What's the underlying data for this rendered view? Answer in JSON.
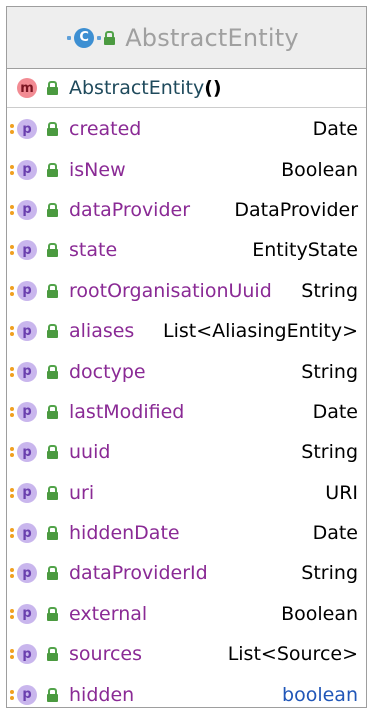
{
  "header": {
    "class_icon": "C",
    "class_name": "AbstractEntity"
  },
  "constructor": {
    "icon": "m",
    "name": "AbstractEntity",
    "parens": "()"
  },
  "property_icon": "p",
  "properties": [
    {
      "name": "created",
      "type": "Date",
      "primitive": false
    },
    {
      "name": "isNew",
      "type": "Boolean",
      "primitive": false
    },
    {
      "name": "dataProvider",
      "type": "DataProvider",
      "primitive": false
    },
    {
      "name": "state",
      "type": "EntityState",
      "primitive": false
    },
    {
      "name": "rootOrganisationUuid",
      "type": "String",
      "primitive": false
    },
    {
      "name": "aliases",
      "type": "List<AliasingEntity>",
      "primitive": false
    },
    {
      "name": "doctype",
      "type": "String",
      "primitive": false
    },
    {
      "name": "lastModified",
      "type": "Date",
      "primitive": false
    },
    {
      "name": "uuid",
      "type": "String",
      "primitive": false
    },
    {
      "name": "uri",
      "type": "URI",
      "primitive": false
    },
    {
      "name": "hiddenDate",
      "type": "Date",
      "primitive": false
    },
    {
      "name": "dataProviderId",
      "type": "String",
      "primitive": false
    },
    {
      "name": "external",
      "type": "Boolean",
      "primitive": false
    },
    {
      "name": "sources",
      "type": "List<Source>",
      "primitive": false
    },
    {
      "name": "hidden",
      "type": "boolean",
      "primitive": true
    }
  ],
  "colors": {
    "class_icon": "#3d8fd2",
    "method_icon": "#f28b93",
    "property_icon": "#c9b6ed",
    "lock": "#4b9a40",
    "member_name": "#8a2a95",
    "primitive_type": "#2056b8"
  }
}
